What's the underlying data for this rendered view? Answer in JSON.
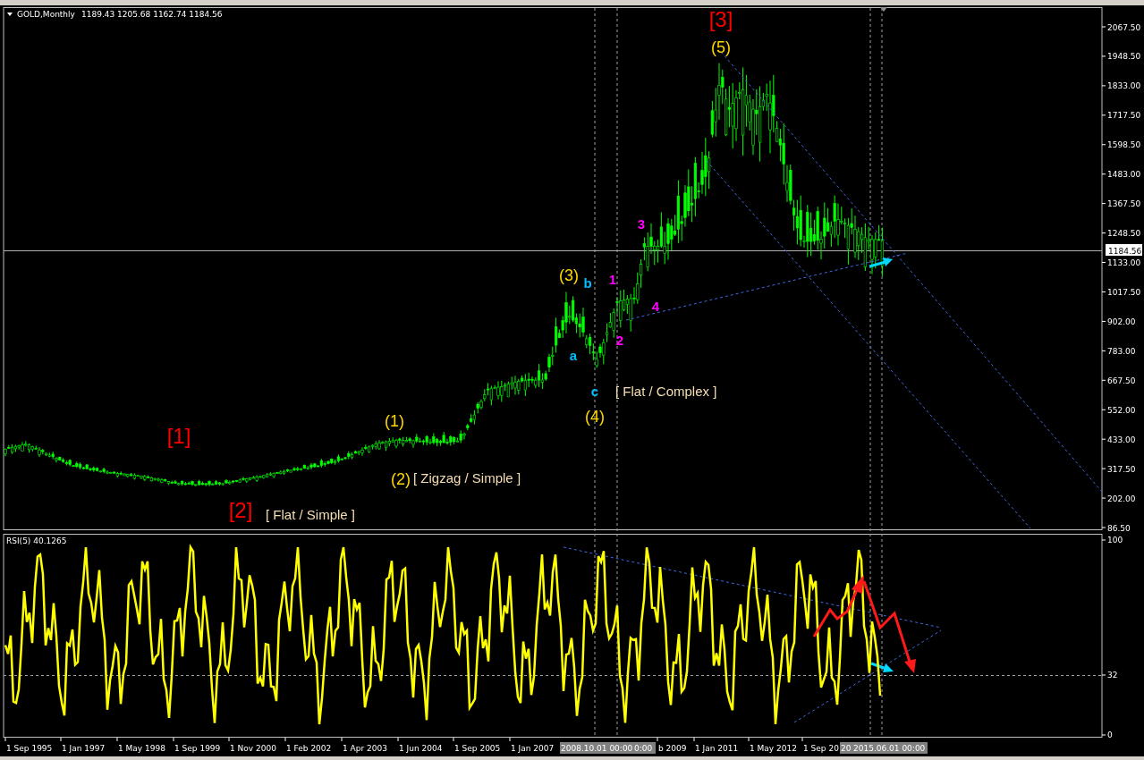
{
  "price_panel": {
    "symbol": "GOLD,Monthly",
    "ohlc": [
      "1189.43",
      "1205.68",
      "1162.74",
      "1184.56"
    ],
    "ticks": [
      "2067.50",
      "1948.50",
      "1833.00",
      "1717.50",
      "1598.50",
      "1483.00",
      "1367.50",
      "1248.50",
      "1133.00",
      "1017.50",
      "902.00",
      "783.00",
      "667.50",
      "552.00",
      "433.00",
      "317.50",
      "202.00",
      "86.50"
    ],
    "current_price": "1184.56",
    "annotations": [
      {
        "text": "[3]",
        "kind": "primary",
        "color": "#ff0000"
      },
      {
        "text": "(5)",
        "kind": "intermediate",
        "color": "#ffd700"
      },
      {
        "text": "3",
        "kind": "minor",
        "color": "#ff00ff"
      },
      {
        "text": "(3)",
        "kind": "intermediate",
        "color": "#ffd700"
      },
      {
        "text": "b",
        "kind": "minor",
        "color": "#00bfff"
      },
      {
        "text": "1",
        "kind": "minor",
        "color": "#ff00ff"
      },
      {
        "text": "4",
        "kind": "minor",
        "color": "#ff00ff"
      },
      {
        "text": "2",
        "kind": "minor",
        "color": "#ff00ff"
      },
      {
        "text": "a",
        "kind": "minor",
        "color": "#00bfff"
      },
      {
        "text": "c",
        "kind": "minor",
        "color": "#00bfff"
      },
      {
        "text": "[ Flat / Complex ]",
        "kind": "note",
        "color": "#f5deb3"
      },
      {
        "text": "(4)",
        "kind": "intermediate",
        "color": "#ffd700"
      },
      {
        "text": "(1)",
        "kind": "intermediate",
        "color": "#ffd700"
      },
      {
        "text": "[1]",
        "kind": "primary",
        "color": "#ff0000"
      },
      {
        "text": "(2)",
        "kind": "intermediate",
        "color": "#ffd700"
      },
      {
        "text": "[ Zigzag / Simple ]",
        "kind": "note",
        "color": "#f5deb3"
      },
      {
        "text": "[2]",
        "kind": "primary",
        "color": "#ff0000"
      },
      {
        "text": "[ Flat / Simple ]",
        "kind": "note",
        "color": "#f5deb3"
      }
    ]
  },
  "rsi_panel": {
    "title": "RSI(5) 40.1265",
    "ticks": [
      "100",
      "32",
      "0"
    ]
  },
  "time_axis": {
    "labels": [
      "1 Sep 1995",
      "1 Jan 1997",
      "1 May 1998",
      "1 Sep 1999",
      "1 Nov 2000",
      "1 Feb 2002",
      "1 Apr 2003",
      "1 Jun 2004",
      "1 Sep 2005",
      "1 Jan 2007",
      "b 2009",
      "1 Jan 2011",
      "1 May 2012",
      "1 Sep 20"
    ],
    "markers": [
      "2008.10.01 00:00",
      "0:00",
      "20",
      "2015.06.01 00:00"
    ]
  }
}
